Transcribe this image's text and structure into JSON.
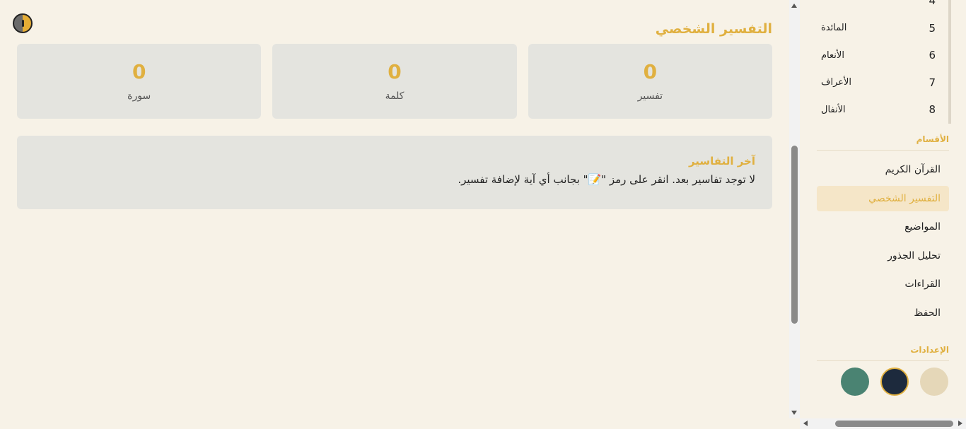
{
  "main": {
    "title": "التفسير الشخصي",
    "stats": [
      {
        "value": "0",
        "label": "تفسير"
      },
      {
        "value": "0",
        "label": "كلمة"
      },
      {
        "value": "0",
        "label": "سورة"
      }
    ],
    "recent": {
      "title": "آخر التفاسير",
      "empty_message": "لا توجد تفاسير بعد. انقر على رمز \"📝\" بجانب أي آية لإضافة تفسير."
    }
  },
  "sidebar": {
    "surahs": [
      {
        "number": "4",
        "name": ""
      },
      {
        "number": "5",
        "name": "المائدة"
      },
      {
        "number": "6",
        "name": "الأنعام"
      },
      {
        "number": "7",
        "name": "الأعراف"
      },
      {
        "number": "8",
        "name": "الأنفال"
      }
    ],
    "sections_title": "الأقسام",
    "nav": [
      {
        "label": "القرآن الكريم"
      },
      {
        "label": "التفسير الشخصي"
      },
      {
        "label": "المواضيع"
      },
      {
        "label": "تحليل الجذور"
      },
      {
        "label": "القراءات"
      },
      {
        "label": "الحفظ"
      }
    ],
    "settings_title": "الإعدادات",
    "themes": [
      {
        "name": "light",
        "color": "#e5d7b8"
      },
      {
        "name": "dark",
        "color": "#1d2a3d"
      },
      {
        "name": "green",
        "color": "#4a8372"
      }
    ]
  },
  "colors": {
    "accent": "#e0b040",
    "background": "#f7f2e7",
    "card": "#e4e4df",
    "active_nav": "#f5e6c8"
  }
}
